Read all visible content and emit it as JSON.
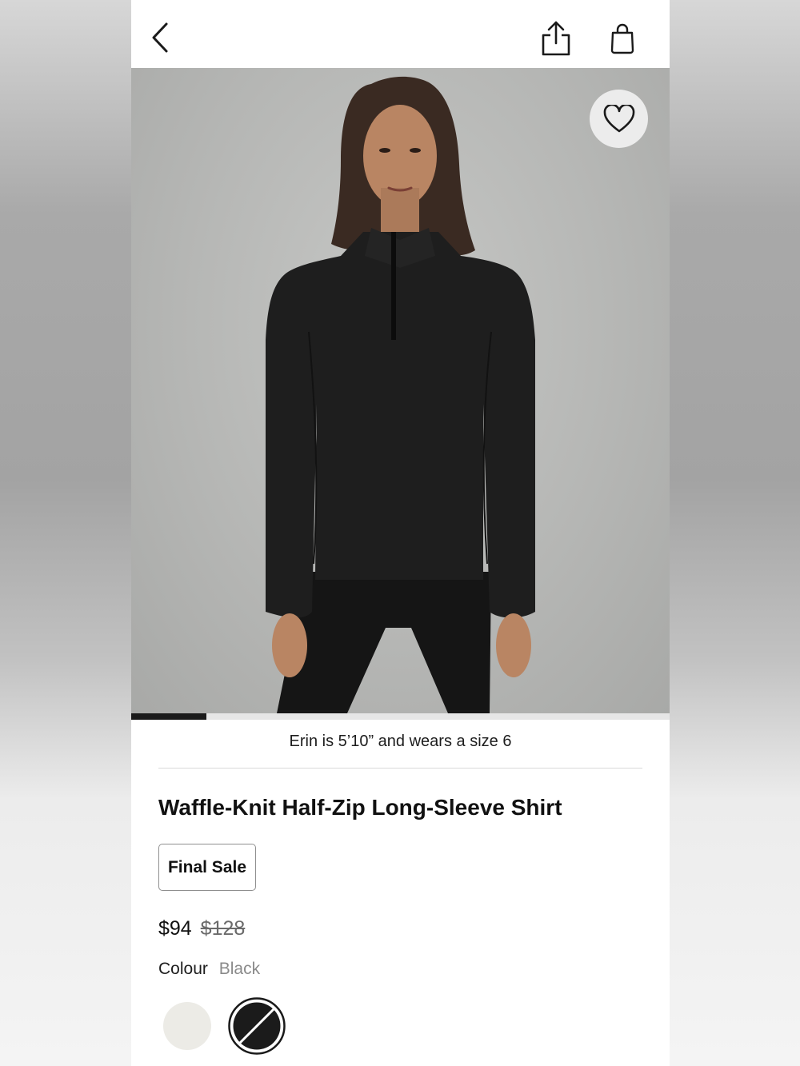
{
  "header": {
    "back_icon": "chevron-left-icon",
    "share_icon": "share-icon",
    "bag_icon": "shopping-bag-icon"
  },
  "gallery": {
    "favorite_icon": "heart-icon",
    "progress": 0.14,
    "model_info": "Erin is 5’10” and wears a size 6"
  },
  "product": {
    "title": "Waffle-Knit Half-Zip Long-Sleeve Shirt",
    "badge": "Final Sale",
    "price": "$94",
    "original_price": "$128",
    "colour_label": "Colour",
    "colour_value": "Black",
    "swatches": [
      {
        "color": "#ecebe6",
        "selected": false
      },
      {
        "color": "#1b1b1b",
        "selected": true
      }
    ]
  },
  "colors": {
    "background": "#ffffff",
    "text": "#111111",
    "muted": "#8a8a8a",
    "progress": "#1a1a1a"
  }
}
